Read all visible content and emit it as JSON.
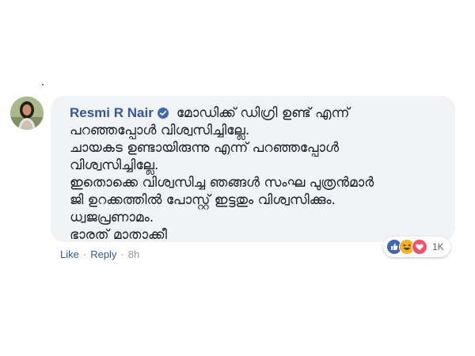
{
  "comment": {
    "author": "Resmi R Nair",
    "verified_icon": "verified-check-icon",
    "lines": [
      "മോഡിക്ക് ഡിഗ്രി ഉണ്ട് എന്ന്",
      "പറഞ്ഞപ്പോൾ വിശ്വസിച്ചില്ലേ.",
      "ചായകട ഉണ്ടായിരുന്നു എന്ന് പറഞ്ഞപ്പോൾ",
      "വിശ്വസിച്ചില്ലേ.",
      "ഇതൊക്കെ വിശ്വസിച്ച ഞങ്ങൾ സംഘ പുത്രൻമാർ",
      "ജി ഉറക്കത്തിൽ പോസ്റ്റ് ഇട്ടതും വിശ്വസിക്കും.",
      "ധ്വജപ്രണാമം.",
      "ഭാരത് മാതാക്കീ"
    ]
  },
  "reactions": {
    "icons": [
      "like-reaction-icon",
      "haha-reaction-icon",
      "love-reaction-icon"
    ],
    "count": "1K"
  },
  "actions": {
    "like": "Like",
    "reply": "Reply",
    "separator": "·",
    "time": "8h"
  },
  "colors": {
    "link": "#365899",
    "bubble": "#f2f3f5",
    "text": "#1d2129",
    "meta": "#90949c"
  }
}
